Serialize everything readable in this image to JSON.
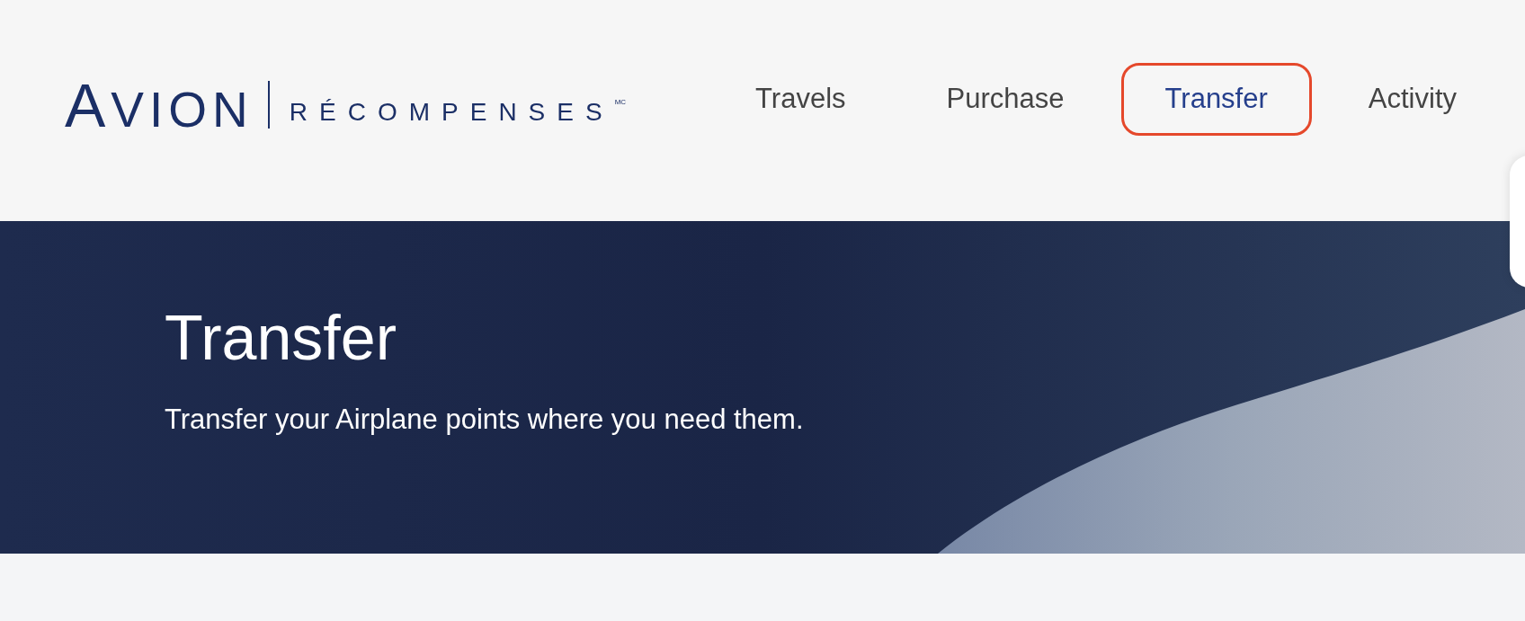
{
  "logo": {
    "wordmark": "AVION",
    "tagline": "RÉCOMPENSES",
    "trademark": "MC"
  },
  "nav": {
    "tabs": [
      {
        "label": "Travels",
        "selected": false
      },
      {
        "label": "Purchase",
        "selected": false
      },
      {
        "label": "Transfer",
        "selected": true
      },
      {
        "label": "Activity",
        "selected": false
      }
    ]
  },
  "hero": {
    "title": "Transfer",
    "subtitle": "Transfer your Airplane points where you need them."
  }
}
